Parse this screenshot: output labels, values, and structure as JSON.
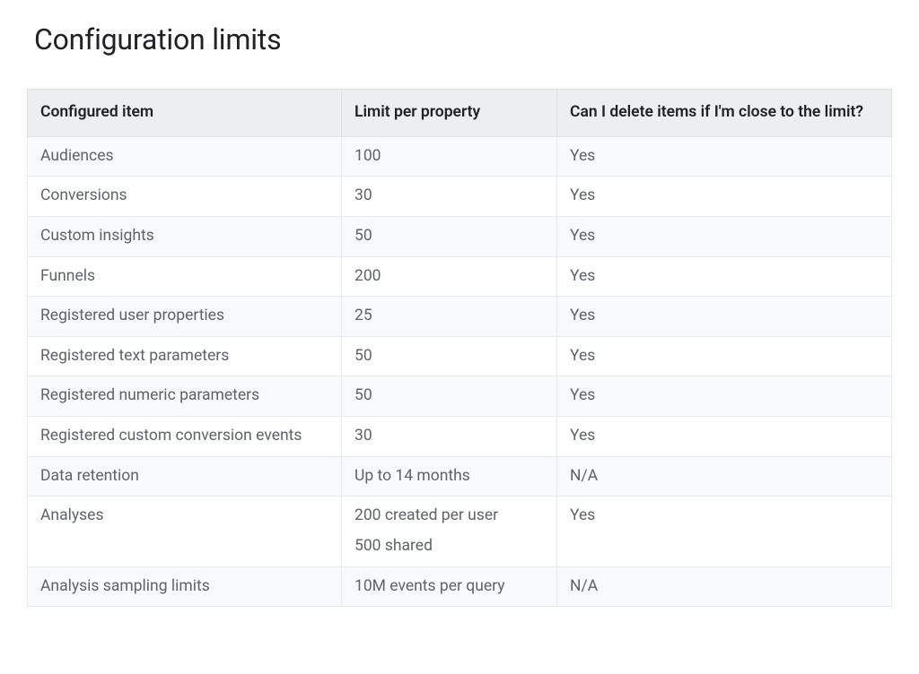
{
  "title": "Configuration limits",
  "chart_data": {
    "type": "table",
    "columns": [
      "Configured  item",
      "Limit per property",
      "Can I delete items if I'm close to the limit?"
    ],
    "rows": [
      [
        "Audiences",
        "100",
        "Yes"
      ],
      [
        "Conversions",
        "30",
        "Yes"
      ],
      [
        "Custom insights",
        "50",
        "Yes"
      ],
      [
        "Funnels",
        "200",
        "Yes"
      ],
      [
        "Registered user properties",
        "25",
        "Yes"
      ],
      [
        "Registered text parameters",
        "50",
        "Yes"
      ],
      [
        "Registered numeric parameters",
        "50",
        "Yes"
      ],
      [
        "Registered custom conversion events",
        "30",
        "Yes"
      ],
      [
        "Data retention",
        "Up to 14 months",
        "N/A"
      ],
      [
        "Analyses",
        "200 created per user\n500 shared",
        "Yes"
      ],
      [
        "Analysis sampling limits",
        "10M events per query",
        "N/A"
      ]
    ]
  }
}
